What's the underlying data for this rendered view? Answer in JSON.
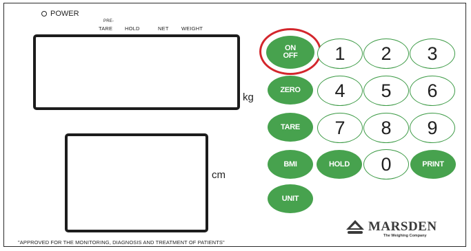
{
  "indicators": {
    "power": "POWER",
    "pre": "PRE-",
    "tare": "TARE",
    "hold": "HOLD",
    "net": "NET",
    "weight": "WEIGHT"
  },
  "units": {
    "weight": "kg",
    "height": "cm"
  },
  "keys": {
    "on": "ON",
    "off": "OFF",
    "zero": "ZERO",
    "tare": "TARE",
    "bmi": "BMI",
    "hold": "HOLD",
    "print": "PRINT",
    "unit": "UNIT",
    "d1": "1",
    "d2": "2",
    "d3": "3",
    "d4": "4",
    "d5": "5",
    "d6": "6",
    "d7": "7",
    "d8": "8",
    "d9": "9",
    "d0": "0"
  },
  "brand": {
    "name": "MARSDEN",
    "tagline": "The Weighing Company"
  },
  "footer": "\"APPROVED FOR THE MONITORING, DIAGNOSIS AND TREATMENT OF PATIENTS\"",
  "colors": {
    "key_green": "#47a24e",
    "highlight_red": "#d3262c"
  }
}
